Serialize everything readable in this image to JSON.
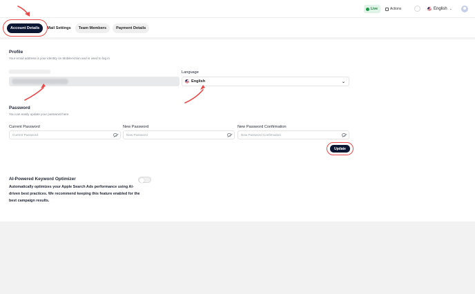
{
  "topbar": {
    "live_label": "Live",
    "actions_label": "Actions",
    "language_label": "English"
  },
  "tabs": [
    {
      "label": "Account Details",
      "active": true
    },
    {
      "label": "Mail Settings",
      "active": false
    },
    {
      "label": "Team Members",
      "active": false
    },
    {
      "label": "Payment Details",
      "active": false
    }
  ],
  "profile": {
    "title": "Profile",
    "subtitle": "Your email address is your identity on MobileAction and is used to log in",
    "language_label": "Language",
    "language_value": "English"
  },
  "password": {
    "title": "Password",
    "subtitle": "You can easily update your password here",
    "current_label": "Current Password",
    "current_placeholder": "Current Password",
    "new_label": "New Password",
    "new_placeholder": "New Password",
    "confirm_label": "New Password Confirmation",
    "confirm_placeholder": "New Password Confirmation",
    "update_label": "Update"
  },
  "ai_optimizer": {
    "title": "AI-Powered Keyword Optimizer",
    "description": "Automatically optimizes your Apple Search Ads performance using AI-driven best practices. We recommend keeping this feature enabled for the best campaign results.",
    "enabled": false
  },
  "colors": {
    "accent": "#0b1633",
    "annotation": "#e64a4a",
    "live": "#1f9a4d"
  }
}
